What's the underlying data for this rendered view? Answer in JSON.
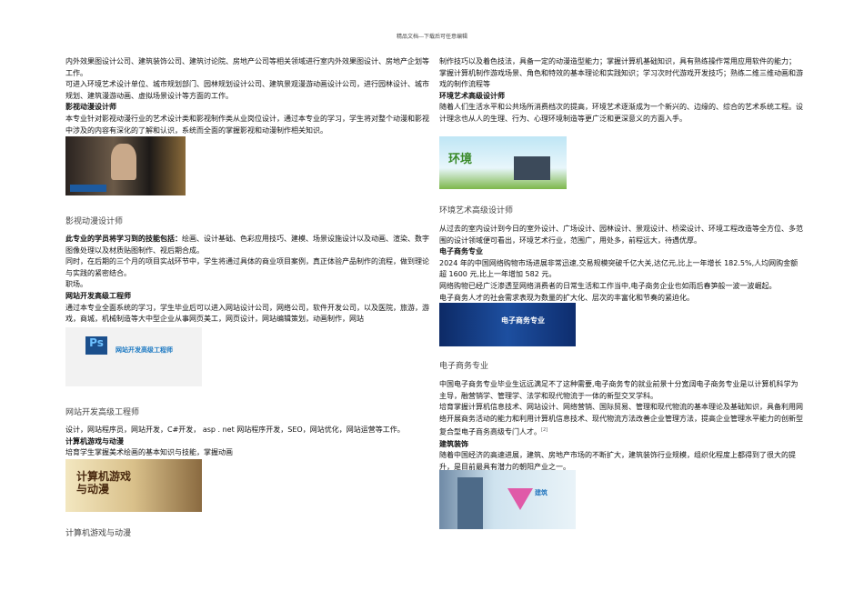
{
  "header": "精品文档---下载后可任意编辑",
  "left": {
    "block1": [
      "内外效果图设计公司、建筑装饰公司、建筑讨论院、房地产公司等相关领域进行室内外效果图设计、房地产企划等工作。",
      "可进入环境艺术设计单位、城市规划部门、园林规划设计公司、建筑景观漫游动画设计公司，进行园林设计、城市规划、建筑漫游动画、虚拟场景设计等方面的工作。"
    ],
    "h1": "影视动漫设计师",
    "p1": "本专业针对影视动漫行业的艺术设计类和影视制作类从业岗位设计，通过本专业的学习，学生将对整个动漫和影视中涉及的内容有深化的了解和认识，系统而全面的掌握影视和动漫制作相关知识。",
    "cap1": "影视动漫设计师",
    "skills_label": "此专业的学员将学习到的技能包括：",
    "skills": "绘画、设计基础、色彩应用技巧、建模、场景设施设计以及动画、渲染、数字图像处理以及材质贴图制作、视后期合成。",
    "p2": "同时，在后期的三个月的项目实战环节中，学生将通过具体的商业项目案例，真正体验产品制作的流程，做到理论与实践的紧密结合。",
    "p3": "职场。",
    "h2": "网站开发高级工程师",
    "p4": "通过本专业全面系统的学习，学生毕业后可以进入网站设计公司，网络公司，软件开发公司，以及医院，旅游，游戏，商城，机械制造等大中型企业从事网页美工，网页设计，网站编辑策划，动画制作，网站",
    "img2_text": "网站开发高级工程师",
    "cap2": "网站开发高级工程师",
    "p5": "设计，网站程序员，网站开发，C#开发， asp . net 网站程序开发，SEO，网站优化，网站运营等工作。",
    "h3": "计算机游戏与动漫",
    "p6": "培育学生掌握美术绘画的基本知识与技能，掌握动画",
    "img3_text": "计算机游戏与动漫",
    "cap3": "计算机游戏与动漫"
  },
  "right": {
    "p1": "制作技巧以及着色技法，具备一定的动漫造型能力；掌握计算机基础知识，具有熟练操作常用应用软件的能力；",
    "p2": "掌握计算机制作游戏场景、角色和特效的基本理论和实践知识；学习次时代游戏开发技巧；熟练二维三维动画和游戏的制作流程等",
    "h1": "环境艺术高级设计师",
    "p3": "随着人们生活水平和公共场所消费档次的提高，环境艺术逐渐成为一个新兴的、边缘的、综合的艺术系统工程。设计理念也从人的生理、行为、心理环境制造等更广泛和更深意义的方面入手。",
    "img1_text": "环境",
    "cap1": "环境艺术高级设计师",
    "p4": "从过去的室内设计到今日的室外设计、广场设计、园林设计、景观设计、桥梁设计、环境工程改造等全方位、多范围的设计领域便可看出，环境艺术行业，范围广，用处多，前程远大，待遇优厚。",
    "h2": "电子商务专业",
    "p5": "2024 年的中国网络购物市场进展非常迅速,交易规模突破千亿大关,达亿元,比上一年增长 182.5%,人均网购金额超 1600 元,比上一年增加 582 元。",
    "p6": "网络购物已经广泛渗透至网络消费者的日常生活和工作当中,电子商务企业也如雨后春笋般一波一波崛起。",
    "p7": "电子商务人才的社会需求表现为数量的扩大化、层次的丰富化和节奏的紧迫化。",
    "img2_text": "电子商务专业",
    "cap2": "电子商务专业",
    "p8": "中国电子商务专业毕业生远远满足不了这种需要,电子商务专的就业前景十分宽阔电子商务专业是以计算机科学为主导，融营销学、管理学、法学和现代物流于一体的新型交叉学科。",
    "p9": "培育掌握计算机信息技术、网站设计、网络营销、国际贸易、管理和现代物流的基本理论及基础知识，具备利用网络开展商务活动的能力和利用计算机信息技术、现代物流方法改善企业管理方法，提高企业管理水平能力的创新型复合型电子商务高级专门人才。",
    "ref": "[2]",
    "h3": "建筑装饰",
    "p10": "随着中国经济的高速进展，建筑、房地产市场的不断扩大，建筑装饰行业规模，组织化程度上都得到了很大的提升，是目前最具有潜力的朝阳产业之一。",
    "img3_text": "建筑"
  }
}
